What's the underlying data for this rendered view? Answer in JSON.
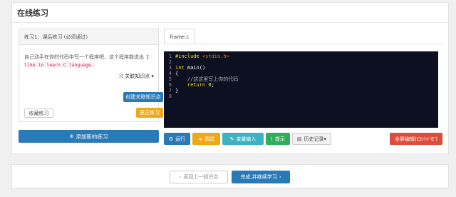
{
  "page": {
    "title": "在线练习"
  },
  "exercise": {
    "header": "练习1：课后练习 (必须通过)",
    "text_before": "自己动手在你的代码中写一个程序吧，这个程序能说出",
    "code": "I like to learn C language.",
    "text_after": "",
    "related_label": "关联知识点",
    "create_button": "创建关联知识点",
    "receive_button": "收藏练习",
    "update_button": "更正练习",
    "add_button": "添加新的练习"
  },
  "editor": {
    "tab": "frame.c",
    "line_numbers": [
      "1",
      "2",
      "3",
      "4",
      "5",
      "6",
      "7",
      "8"
    ],
    "lines": {
      "l1_pp": "#include",
      "l1_inc": " <stdio.h>",
      "l3_kw": "int",
      "l3_rest": " main()",
      "l4": "{",
      "l5_cm": "    //这这里写上你的代码",
      "l6_kw": "    return",
      "l6_num": " 0",
      "l6_end": ";",
      "l7": "}"
    }
  },
  "toolbar": {
    "run": "运行",
    "debug": "调试",
    "var_input": "变量输入",
    "hint": "提示",
    "history": "历史记录",
    "fullscreen": "全屏编辑(Ctrl+'E')"
  },
  "footer": {
    "prev": "返回上一知识点",
    "next": "完成,并继续学习"
  },
  "colors": {
    "primary": "#2a7ab8",
    "warning": "#f0a818",
    "info": "#3bb3c3",
    "success": "#2fae5a",
    "danger": "#e04b3a",
    "editor_bg": "#0d1021"
  }
}
